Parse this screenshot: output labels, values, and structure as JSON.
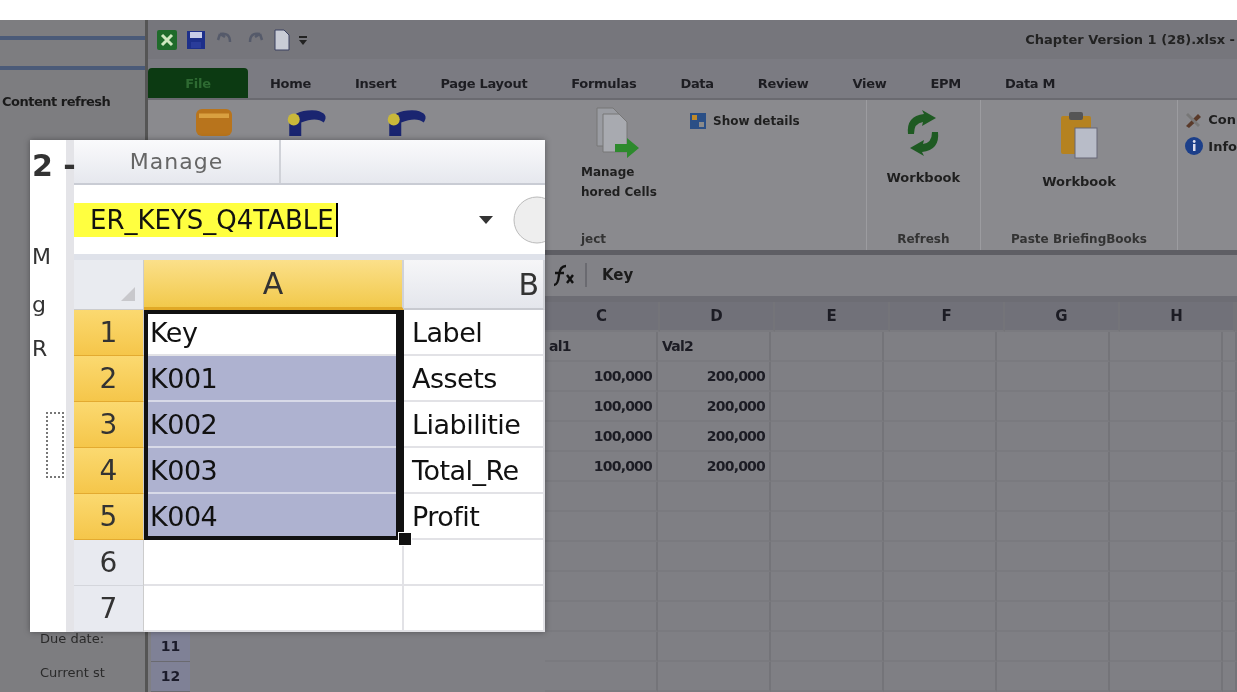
{
  "side_panel": {
    "heading": "Content refresh",
    "labels": [
      "Due date:",
      "Current st"
    ]
  },
  "title": "Chapter Version 1 (28).xlsx -",
  "tabs": [
    {
      "label": "File",
      "kind": "file"
    },
    {
      "label": "Home",
      "kind": "tab"
    },
    {
      "label": "Insert",
      "kind": "tab"
    },
    {
      "label": "Page Layout",
      "kind": "tab"
    },
    {
      "label": "Formulas",
      "kind": "tab"
    },
    {
      "label": "Data",
      "kind": "tab"
    },
    {
      "label": "Review",
      "kind": "tab"
    },
    {
      "label": "View",
      "kind": "tab"
    },
    {
      "label": "EPM",
      "kind": "tab"
    },
    {
      "label": "Data M",
      "kind": "tab"
    }
  ],
  "ribbon": {
    "manage_lines": [
      "Manage",
      "hored Cells"
    ],
    "manage_group": "ject",
    "show_details": "Show details",
    "refresh_button": "Workbook",
    "refresh_group": "Refresh",
    "paste_button": "Workbook",
    "paste_group": "Paste BriefingBooks",
    "side_items": [
      "Con",
      "Info"
    ]
  },
  "formula_bar": {
    "value": "Key"
  },
  "sheet": {
    "columns": [
      "C",
      "D",
      "E",
      "F",
      "G",
      "H"
    ],
    "rows": [
      {
        "cells": [
          "al1",
          "Val2"
        ]
      },
      {
        "cells": [
          "100,000",
          "200,000"
        ]
      },
      {
        "cells": [
          "100,000",
          "200,000"
        ]
      },
      {
        "cells": [
          "100,000",
          "200,000"
        ]
      },
      {
        "cells": [
          "100,000",
          "200,000"
        ]
      }
    ],
    "row_numbers": [
      "11",
      "12"
    ]
  },
  "zoom_inset": {
    "fragments": [
      "2 -",
      "M",
      "g",
      "R"
    ],
    "tab": "Manage",
    "name_box": "ER_KEYS_Q4TABLE",
    "columns": [
      {
        "label": "A",
        "selected": true
      },
      {
        "label": "B",
        "selected": false
      }
    ],
    "rows": [
      {
        "number": "1",
        "selected": true,
        "cells": [
          {
            "text": "Key",
            "highlighted": false
          },
          {
            "text": "Label",
            "highlighted": false
          }
        ]
      },
      {
        "number": "2",
        "selected": true,
        "cells": [
          {
            "text": "K001",
            "highlighted": true
          },
          {
            "text": "Assets",
            "highlighted": false
          }
        ]
      },
      {
        "number": "3",
        "selected": true,
        "cells": [
          {
            "text": "K002",
            "highlighted": true
          },
          {
            "text": "Liabilitie",
            "highlighted": false
          }
        ]
      },
      {
        "number": "4",
        "selected": true,
        "cells": [
          {
            "text": "K003",
            "highlighted": true
          },
          {
            "text": "Total_Re",
            "highlighted": false
          }
        ]
      },
      {
        "number": "5",
        "selected": true,
        "cells": [
          {
            "text": "K004",
            "highlighted": true
          },
          {
            "text": "Profit",
            "highlighted": false
          }
        ]
      },
      {
        "number": "6",
        "selected": false
      },
      {
        "number": "7",
        "selected": false
      }
    ]
  }
}
